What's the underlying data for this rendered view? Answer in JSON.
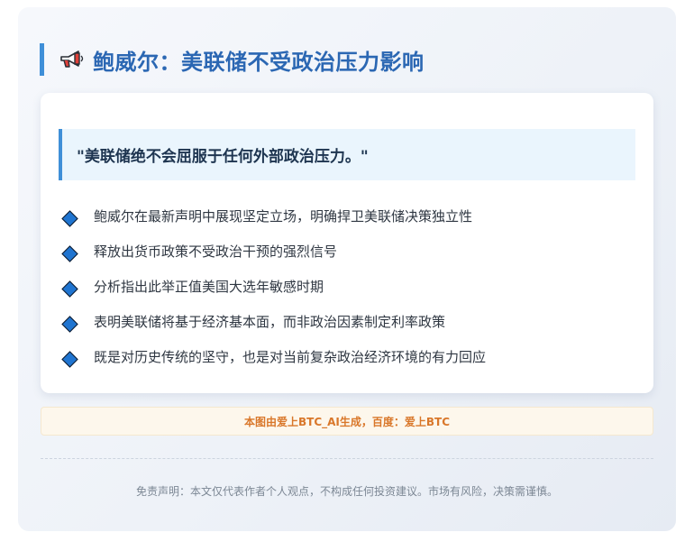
{
  "header": {
    "icon": "megaphone-icon",
    "title": "鲍威尔：美联储不受政治压力影响"
  },
  "quote": {
    "text": "\"美联储绝不会屈服于任何外部政治压力。\""
  },
  "points": [
    {
      "text": "鲍威尔在最新声明中展现坚定立场，明确捍卫美联储决策独立性"
    },
    {
      "text": "释放出货币政策不受政治干预的强烈信号"
    },
    {
      "text": "分析指出此举正值美国大选年敏感时期"
    },
    {
      "text": "表明美联储将基于经济基本面，而非政治因素制定利率政策"
    },
    {
      "text": "既是对历史传统的坚守，也是对当前复杂政治经济环境的有力回应"
    }
  ],
  "credit": {
    "text": "本图由爱上BTC_AI生成，百度：爱上BTC"
  },
  "footer": {
    "disclaimer": "免责声明：本文仅代表作者个人观点，不构成任何投资建议。市场有风险，决策需谨慎。"
  },
  "colors": {
    "accent": "#3f8fd8",
    "title": "#2b67b3",
    "diamond": "#1f74d0",
    "credit": "#d9772a"
  }
}
